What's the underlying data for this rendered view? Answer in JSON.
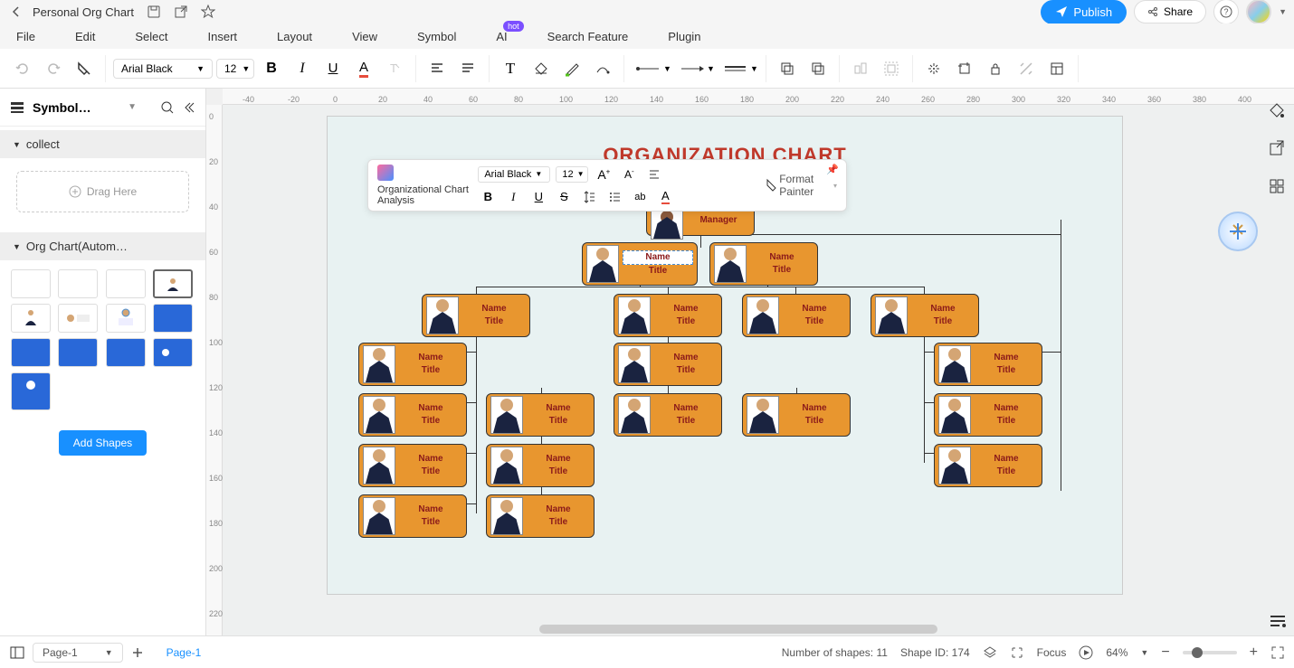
{
  "header": {
    "doc_title": "Personal Org Chart",
    "publish": "Publish",
    "share": "Share"
  },
  "menu": {
    "file": "File",
    "edit": "Edit",
    "select": "Select",
    "insert": "Insert",
    "layout": "Layout",
    "view": "View",
    "symbol": "Symbol",
    "ai": "AI",
    "ai_badge": "hot",
    "search_feature": "Search Feature",
    "plugin": "Plugin"
  },
  "toolbar": {
    "font": "Arial Black",
    "size": "12"
  },
  "sidebar": {
    "title": "Symbol…",
    "collect": "collect",
    "drag_here": "Drag Here",
    "org_section": "Org Chart(Autom…",
    "add_shapes": "Add Shapes"
  },
  "float": {
    "analysis": "Organizational Chart Analysis",
    "font": "Arial Black",
    "size": "12",
    "format_painter": "Format Painter"
  },
  "chart": {
    "title": "ORGANIZATION CHART",
    "manager": "Manager",
    "name": "Name",
    "title_label": "Title"
  },
  "ruler_h": [
    "-40",
    "-20",
    "0",
    "20",
    "40",
    "60",
    "80",
    "100",
    "120",
    "140",
    "160",
    "180",
    "200",
    "220",
    "240",
    "260",
    "280",
    "300",
    "320",
    "340",
    "360",
    "380",
    "400"
  ],
  "ruler_v": [
    "0",
    "20",
    "40",
    "60",
    "80",
    "100",
    "120",
    "140",
    "160",
    "180",
    "200",
    "220"
  ],
  "status": {
    "page_sel": "Page-1",
    "page_tab": "Page-1",
    "shapes_count": "Number of shapes: 11",
    "shape_id": "Shape ID: 174",
    "focus": "Focus",
    "zoom": "64%"
  }
}
